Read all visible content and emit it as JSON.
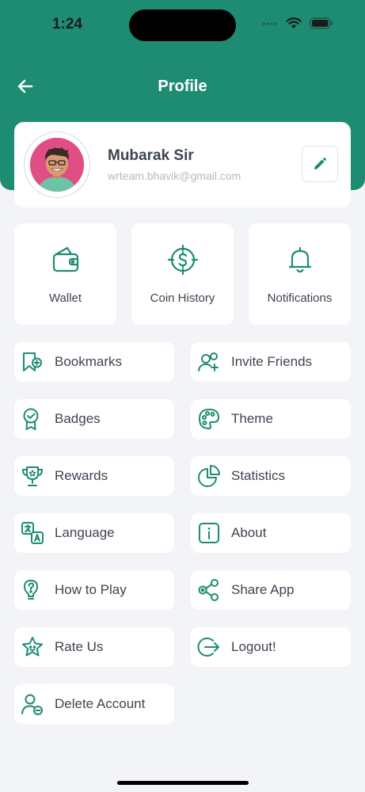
{
  "status_bar": {
    "time": "1:24"
  },
  "header": {
    "title": "Profile"
  },
  "profile": {
    "name": "Mubarak Sir",
    "email": "wrteam.bhavik@gmail.com"
  },
  "colors": {
    "brand": "#1E8C73",
    "background": "#F3F4F8",
    "card": "#FFFFFF",
    "text": "#3E4550",
    "muted": "#B5B9C0"
  },
  "features": [
    {
      "label": "Wallet",
      "icon": "wallet-icon"
    },
    {
      "label": "Coin History",
      "icon": "coin-history-icon"
    },
    {
      "label": "Notifications",
      "icon": "bell-icon"
    }
  ],
  "menu": [
    {
      "label": "Bookmarks",
      "icon": "bookmark-icon"
    },
    {
      "label": "Invite Friends",
      "icon": "invite-friends-icon"
    },
    {
      "label": "Badges",
      "icon": "badge-icon"
    },
    {
      "label": "Theme",
      "icon": "palette-icon"
    },
    {
      "label": "Rewards",
      "icon": "trophy-icon"
    },
    {
      "label": "Statistics",
      "icon": "pie-chart-icon"
    },
    {
      "label": "Language",
      "icon": "language-icon"
    },
    {
      "label": "About",
      "icon": "info-icon"
    },
    {
      "label": "How to Play",
      "icon": "lightbulb-icon"
    },
    {
      "label": "Share App",
      "icon": "share-icon"
    },
    {
      "label": "Rate Us",
      "icon": "star-icon"
    },
    {
      "label": "Logout!",
      "icon": "logout-icon"
    },
    {
      "label": "Delete Account",
      "icon": "delete-account-icon"
    }
  ]
}
